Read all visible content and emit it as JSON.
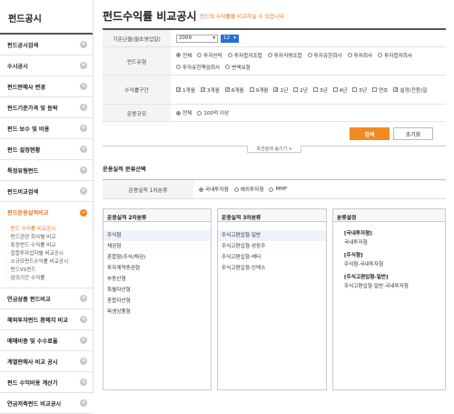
{
  "sidebar": {
    "title": "펀드공시",
    "items": [
      {
        "label": "펀드공시검색",
        "icon": "plus"
      },
      {
        "label": "수시공시",
        "icon": "plus"
      },
      {
        "label": "펀드판매사 변경",
        "icon": "plus"
      },
      {
        "label": "펀드기준가격 및 등락",
        "icon": "plus"
      },
      {
        "label": "펀드 보수 및 비용",
        "icon": "plus"
      },
      {
        "label": "펀드 설정현황",
        "icon": "plus"
      },
      {
        "label": "특정유형펀드",
        "icon": "plus"
      },
      {
        "label": "펀드비교검색",
        "icon": "plus"
      },
      {
        "label": "펀드운용실적비교",
        "icon": "minus"
      }
    ],
    "subitems": [
      "· 펀드 수익률 비교공시",
      "· 펀드관련 회사별 비교",
      "· 특정펀드 수익률 비교",
      "· 집합투자업자별 비교공시",
      "· 소규모펀드수익률 비교공시",
      "· 펀드VS펀드",
      "· 임의기간 수익률"
    ],
    "items_after": [
      {
        "label": "연금상품 펀드비교",
        "icon": "plus"
      },
      {
        "label": "해외투자펀드 환헤지 비교",
        "icon": "plus"
      },
      {
        "label": "매매비중 및 수수료율",
        "icon": "plus"
      },
      {
        "label": "계열판매사 비교 공시",
        "icon": "plus"
      },
      {
        "label": "펀드 수익비용 계산기",
        "icon": "plus"
      },
      {
        "label": "연금저축펀드 비교공시",
        "icon": "plus"
      }
    ]
  },
  "page": {
    "title": "펀드수익률 비교공시",
    "subtitle": "펀드의 수익률을 비교하실 수 있습니다."
  },
  "form": {
    "base_date_label": "기준년월(월초영업일)",
    "year_value": "2009",
    "month_value": "12",
    "fund_type_label": "펀드유형",
    "fund_types": [
      {
        "label": "전체",
        "checked": true
      },
      {
        "label": "투자신탁",
        "checked": false
      },
      {
        "label": "투자합자조합",
        "checked": false
      },
      {
        "label": "투자익명조합",
        "checked": false
      },
      {
        "label": "투자유한회사",
        "checked": false
      },
      {
        "label": "투자회사",
        "checked": false
      },
      {
        "label": "투자합자회사",
        "checked": false
      },
      {
        "label": "투자유한책임회사",
        "checked": false
      },
      {
        "label": "변액보험",
        "checked": false
      }
    ],
    "period_label": "수익률구간",
    "periods": [
      {
        "label": "1개월",
        "checked": true
      },
      {
        "label": "3개월",
        "checked": true
      },
      {
        "label": "6개월",
        "checked": true
      },
      {
        "label": "9개월",
        "checked": false
      },
      {
        "label": "1년",
        "checked": true
      },
      {
        "label": "2년",
        "checked": false
      },
      {
        "label": "3년",
        "checked": false
      },
      {
        "label": "4년",
        "checked": false
      },
      {
        "label": "5년",
        "checked": false
      },
      {
        "label": "연초",
        "checked": false
      },
      {
        "label": "설정(전환)일",
        "checked": true
      }
    ],
    "scale_label": "운용규모",
    "scales": [
      {
        "label": "전체",
        "checked": true
      },
      {
        "label": "100억 이상",
        "checked": false
      }
    ],
    "search_label": "검색",
    "reset_label": "초기화",
    "collapse_label": "조건검색 숨기기 ∧"
  },
  "classification": {
    "title": "운용실적 분류선택",
    "cat1_label": "운용실적 1차분류",
    "cat1_options": [
      {
        "label": "국내투자형",
        "checked": true
      },
      {
        "label": "해외투자형",
        "checked": false
      },
      {
        "label": "MMF",
        "checked": false
      }
    ],
    "cat2_header": "운용실적 2차분류",
    "cat2_items": [
      "주식형",
      "채권형",
      "혼합형(주식/채권)",
      "투자계약증권형",
      "부동산형",
      "특별자산형",
      "혼합자산형",
      "파생상품형"
    ],
    "cat3_header": "운용실적 3차분류",
    "cat3_items": [
      "주식고편입형-일반",
      "주식고편입형-성장주",
      "주식고편입형-섹터",
      "주식고편입형-인덱스"
    ],
    "result_header": "분류설정",
    "result_blocks": [
      {
        "head": "[국내투자형]",
        "value": "국내투자형"
      },
      {
        "head": "[주식형]",
        "value": "주식형-국내투자형"
      },
      {
        "head": "[주식고편입형-일반]",
        "value": "주식고편입형-일반-국내투자형"
      }
    ]
  }
}
